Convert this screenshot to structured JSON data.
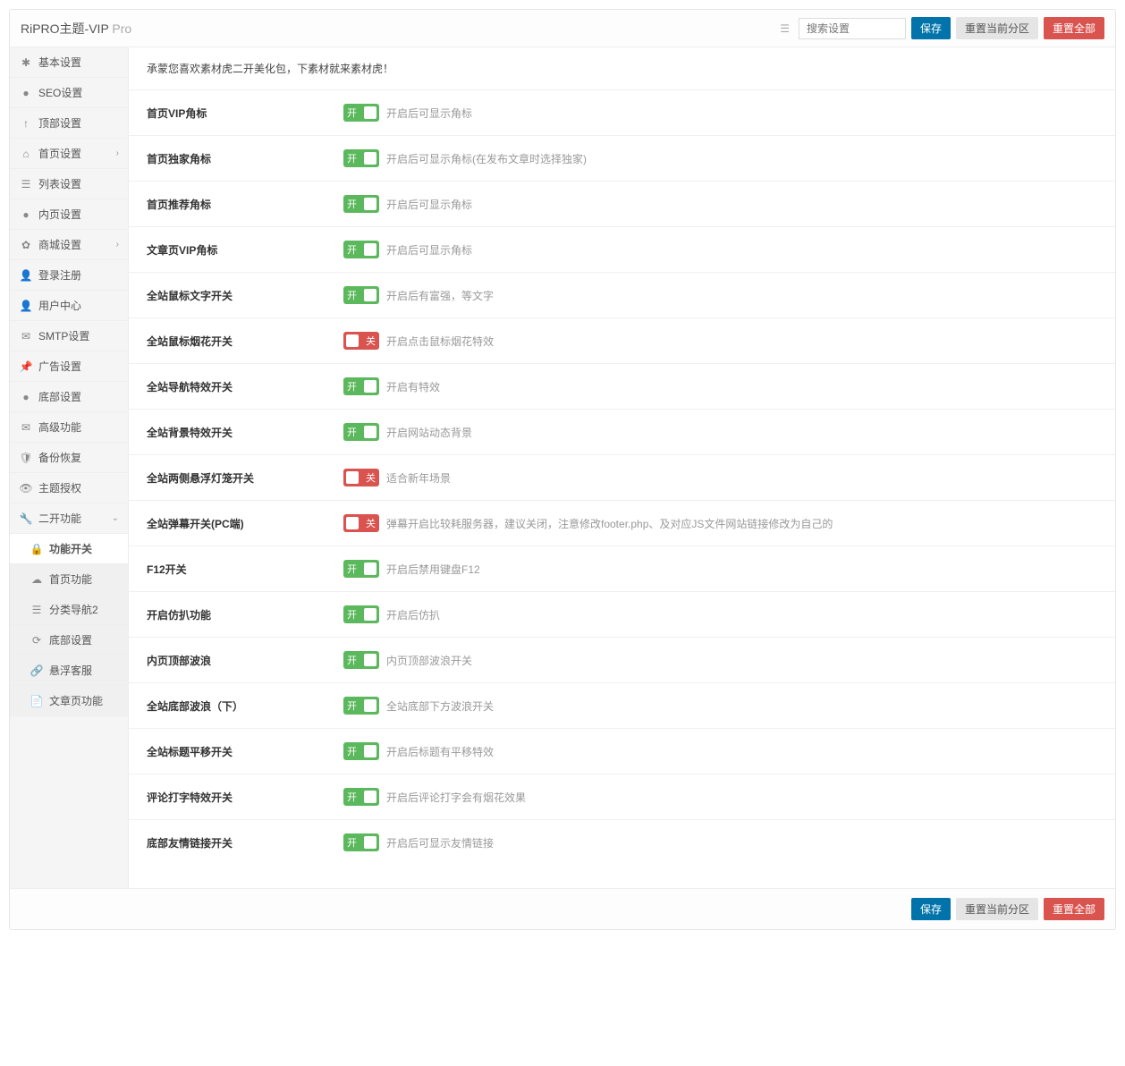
{
  "header": {
    "title_main": "RiPRO主题-VIP",
    "title_suffix": " Pro",
    "search_placeholder": "搜索设置",
    "save_label": "保存",
    "reset_section_label": "重置当前分区",
    "reset_all_label": "重置全部"
  },
  "sidebar": [
    {
      "icon": "✱",
      "label": "基本设置",
      "type": "item"
    },
    {
      "icon": "●",
      "label": "SEO设置",
      "type": "item"
    },
    {
      "icon": "↑",
      "label": "顶部设置",
      "type": "item"
    },
    {
      "icon": "⌂",
      "label": "首页设置",
      "type": "item",
      "expandable": true
    },
    {
      "icon": "☰",
      "label": "列表设置",
      "type": "item"
    },
    {
      "icon": "●",
      "label": "内页设置",
      "type": "item"
    },
    {
      "icon": "✿",
      "label": "商城设置",
      "type": "item",
      "expandable": true
    },
    {
      "icon": "👤",
      "label": "登录注册",
      "type": "item"
    },
    {
      "icon": "👤",
      "label": "用户中心",
      "type": "item"
    },
    {
      "icon": "✉",
      "label": "SMTP设置",
      "type": "item"
    },
    {
      "icon": "📌",
      "label": "广告设置",
      "type": "item"
    },
    {
      "icon": "●",
      "label": "底部设置",
      "type": "item"
    },
    {
      "icon": "✉",
      "label": "高级功能",
      "type": "item"
    },
    {
      "icon": "🛡",
      "label": "备份恢复",
      "type": "item"
    },
    {
      "icon": "👁",
      "label": "主题授权",
      "type": "item"
    },
    {
      "icon": "🔧",
      "label": "二开功能",
      "type": "item",
      "expandable": true,
      "expanded": true
    },
    {
      "icon": "🔒",
      "label": "功能开关",
      "type": "sub",
      "active": true
    },
    {
      "icon": "☁",
      "label": "首页功能",
      "type": "sub"
    },
    {
      "icon": "☰",
      "label": "分类导航2",
      "type": "sub"
    },
    {
      "icon": "⟳",
      "label": "底部设置",
      "type": "sub"
    },
    {
      "icon": "🔗",
      "label": "悬浮客服",
      "type": "sub"
    },
    {
      "icon": "📄",
      "label": "文章页功能",
      "type": "sub"
    }
  ],
  "content": {
    "intro": "承蒙您喜欢素材虎二开美化包，下素材就来素材虎！",
    "settings": [
      {
        "label": "首页VIP角标",
        "state": "on",
        "desc": "开启后可显示角标"
      },
      {
        "label": "首页独家角标",
        "state": "on",
        "desc": "开启后可显示角标(在发布文章时选择独家)"
      },
      {
        "label": "首页推荐角标",
        "state": "on",
        "desc": "开启后可显示角标"
      },
      {
        "label": "文章页VIP角标",
        "state": "on",
        "desc": "开启后可显示角标"
      },
      {
        "label": "全站鼠标文字开关",
        "state": "on",
        "desc": "开启后有富强，等文字"
      },
      {
        "label": "全站鼠标烟花开关",
        "state": "off",
        "desc": "开启点击鼠标烟花特效"
      },
      {
        "label": "全站导航特效开关",
        "state": "on",
        "desc": "开启有特效"
      },
      {
        "label": "全站背景特效开关",
        "state": "on",
        "desc": "开启网站动态背景"
      },
      {
        "label": "全站两侧悬浮灯笼开关",
        "state": "off",
        "desc": "适合新年场景"
      },
      {
        "label": "全站弹幕开关(PC端)",
        "state": "off",
        "desc": "弹幕开启比较耗服务器，建议关闭，注意修改footer.php、及对应JS文件网站链接修改为自己的"
      },
      {
        "label": "F12开关",
        "state": "on",
        "desc": "开启后禁用键盘F12"
      },
      {
        "label": "开启仿扒功能",
        "state": "on",
        "desc": "开启后仿扒"
      },
      {
        "label": "内页顶部波浪",
        "state": "on",
        "desc": "内页顶部波浪开关"
      },
      {
        "label": "全站底部波浪（下）",
        "state": "on",
        "desc": "全站底部下方波浪开关"
      },
      {
        "label": "全站标题平移开关",
        "state": "on",
        "desc": "开启后标题有平移特效"
      },
      {
        "label": "评论打字特效开关",
        "state": "on",
        "desc": "开启后评论打字会有烟花效果"
      },
      {
        "label": "底部友情链接开关",
        "state": "on",
        "desc": "开启后可显示友情链接"
      }
    ]
  },
  "toggle_text": {
    "on": "开",
    "off": "关"
  },
  "footer": {
    "save_label": "保存",
    "reset_section_label": "重置当前分区",
    "reset_all_label": "重置全部"
  }
}
